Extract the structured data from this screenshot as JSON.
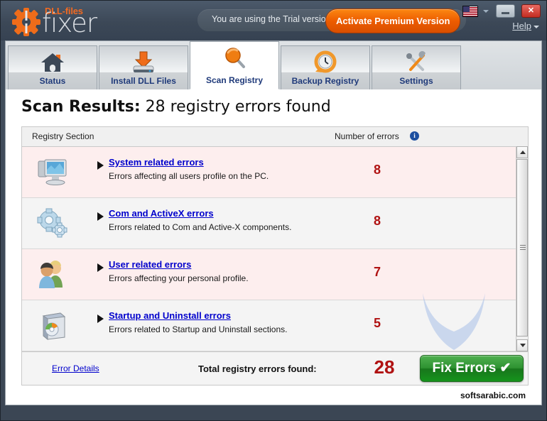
{
  "window": {
    "logo": {
      "brand_top": "DLL-files",
      "brand_main": "fixer",
      "gear_icon": "gear-icon"
    },
    "trial": {
      "message": "You are using the Trial version",
      "activate_label": "Activate Premium Version"
    },
    "controls": {
      "language_flag": "us-flag-icon",
      "language_caret": "chevron-down-icon",
      "minimize_label": "minimize-icon",
      "close_label": "✕",
      "help_label": "Help",
      "help_caret": "chevron-down-icon"
    }
  },
  "tabs": [
    {
      "label": "Status",
      "icon": "home-icon",
      "active": false
    },
    {
      "label": "Install DLL Files",
      "icon": "download-disk-icon",
      "active": false
    },
    {
      "label": "Scan Registry",
      "icon": "magnifier-icon",
      "active": true
    },
    {
      "label": "Backup Registry",
      "icon": "clock-restore-icon",
      "active": false
    },
    {
      "label": "Settings",
      "icon": "tools-icon",
      "active": false
    }
  ],
  "main": {
    "title_bold": "Scan Results:",
    "title_rest": " 28 registry errors found",
    "table": {
      "columns": {
        "section": "Registry Section",
        "errors": "Number of errors",
        "info_icon": "info-icon",
        "info_glyph": "i"
      },
      "rows": [
        {
          "icon": "monitor-icon",
          "title": "System related errors",
          "description": "Errors affecting all users profile on the PC.",
          "count": "8"
        },
        {
          "icon": "gears-icon",
          "title": "Com and ActiveX errors",
          "description": "Errors related to Com and Active-X components.",
          "count": "8"
        },
        {
          "icon": "users-icon",
          "title": "User related errors",
          "description": "Errors affecting your personal profile.",
          "count": "7"
        },
        {
          "icon": "software-box-icon",
          "title": "Startup and Uninstall errors",
          "description": "Errors related to Startup and Uninstall sections.",
          "count": "5"
        }
      ]
    },
    "footer": {
      "error_details": "Error Details",
      "total_label": "Total registry errors found:",
      "total_count": "28",
      "fix_button": "Fix Errors ✔"
    },
    "watermark_letter": "watermark-m-logo",
    "site_watermark": "softsarabic.com"
  },
  "colors": {
    "accent_orange": "#ed5c00",
    "link_blue": "#0000cc",
    "error_red": "#b01212",
    "fix_green": "#18761c",
    "header_navy": "#3c4857",
    "row_pink": "#fdeeee",
    "row_gray": "#f4f4f4"
  }
}
